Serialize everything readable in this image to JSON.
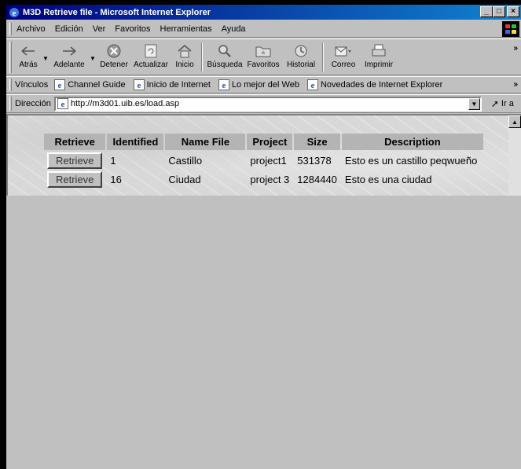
{
  "window": {
    "title": "M3D Retrieve file - Microsoft Internet Explorer"
  },
  "menu": {
    "items": [
      {
        "label": "Archivo"
      },
      {
        "label": "Edición"
      },
      {
        "label": "Ver"
      },
      {
        "label": "Favoritos"
      },
      {
        "label": "Herramientas"
      },
      {
        "label": "Ayuda"
      }
    ]
  },
  "toolbar": {
    "back": "Atrás",
    "forward": "Adelante",
    "stop": "Detener",
    "refresh": "Actualizar",
    "home": "Inicio",
    "search": "Búsqueda",
    "favorites": "Favoritos",
    "history": "Historial",
    "mail": "Correo",
    "print": "Imprimir",
    "more": "»"
  },
  "links": {
    "label": "Vínculos",
    "items": [
      {
        "label": "Channel Guide"
      },
      {
        "label": "Inicio de Internet"
      },
      {
        "label": "Lo mejor del Web"
      },
      {
        "label": "Novedades de Internet Explorer"
      }
    ],
    "more": "»"
  },
  "address": {
    "label": "Dirección",
    "url": "http://m3d01.uib.es/load.asp",
    "go": "Ir a"
  },
  "table": {
    "headers": [
      "Retrieve",
      "Identified",
      "Name File",
      "Project",
      "Size",
      "Description"
    ],
    "rows": [
      {
        "button": "Retrieve",
        "id": "1",
        "name": "Castillo",
        "project": "project1",
        "size": "531378",
        "description": "Esto es un castillo peqwueño"
      },
      {
        "button": "Retrieve",
        "id": "16",
        "name": "Ciudad",
        "project": "project 3",
        "size": "1284440",
        "description": "Esto es una ciudad"
      }
    ]
  },
  "colors": {
    "titlebar_start": "#000080",
    "titlebar_end": "#1084d0",
    "chrome": "#c0c0c0"
  }
}
